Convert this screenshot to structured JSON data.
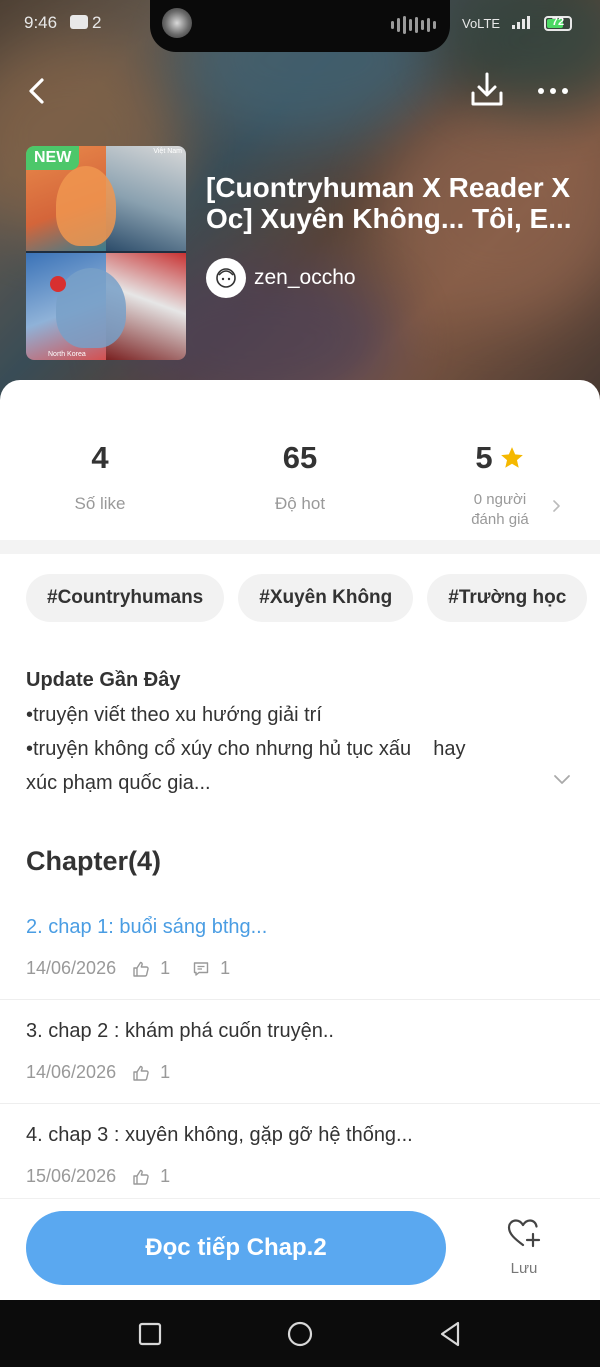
{
  "status_bar": {
    "time": "9:46",
    "notification_count": "2",
    "network": "VoLTE",
    "battery": "72",
    "battery_level": 0.72
  },
  "story": {
    "badge": "NEW",
    "title": "[Cuontryhuman X Reader X Oc] Xuyên Không... Tôi, E...",
    "author": "zen_occho",
    "cover_texts": [
      "Việt Nam",
      "North Korea"
    ]
  },
  "stats": {
    "likes_value": "4",
    "likes_label": "Số like",
    "hot_value": "65",
    "hot_label": "Độ hot",
    "rating_value": "5",
    "rating_label_line1": "0 người",
    "rating_label_line2": "đánh giá"
  },
  "tags": [
    "#Countryhumans",
    "#Xuyên Không",
    "#Trường học"
  ],
  "description": {
    "heading": "Update Gần Đây",
    "lines": [
      "•truyện viết theo xu hướng giải trí",
      "•truyện không cổ xúy cho nhưng hủ tục xấu    hay",
      "xúc phạm quốc gia..."
    ]
  },
  "chapters": {
    "title": "Chapter(4)",
    "items": [
      {
        "name": "2. chap 1: buổi sáng bthg...",
        "date": "14/06/2026",
        "likes": "1",
        "comments": "1",
        "active": true
      },
      {
        "name": "3. chap 2 : khám phá cuốn truyện..",
        "date": "14/06/2026",
        "likes": "1"
      },
      {
        "name": "4. chap 3 : xuyên không, gặp gỡ hệ thống...",
        "date": "15/06/2026",
        "likes": "1"
      }
    ]
  },
  "bottom": {
    "read_button": "Đọc tiếp Chap.2",
    "save_label": "Lưu"
  },
  "colors": {
    "accent": "#5aa8f0",
    "active_chapter": "#4a9de3",
    "new_badge": "#4cc76a",
    "star": "#f5b800"
  },
  "icons": [
    "back-arrow-icon",
    "download-icon",
    "more-icon",
    "star-icon",
    "chevron-right-icon",
    "chevron-down-icon",
    "thumbs-up-icon",
    "comment-icon",
    "heart-plus-icon",
    "nav-recent-icon",
    "nav-home-icon",
    "nav-back-icon"
  ]
}
